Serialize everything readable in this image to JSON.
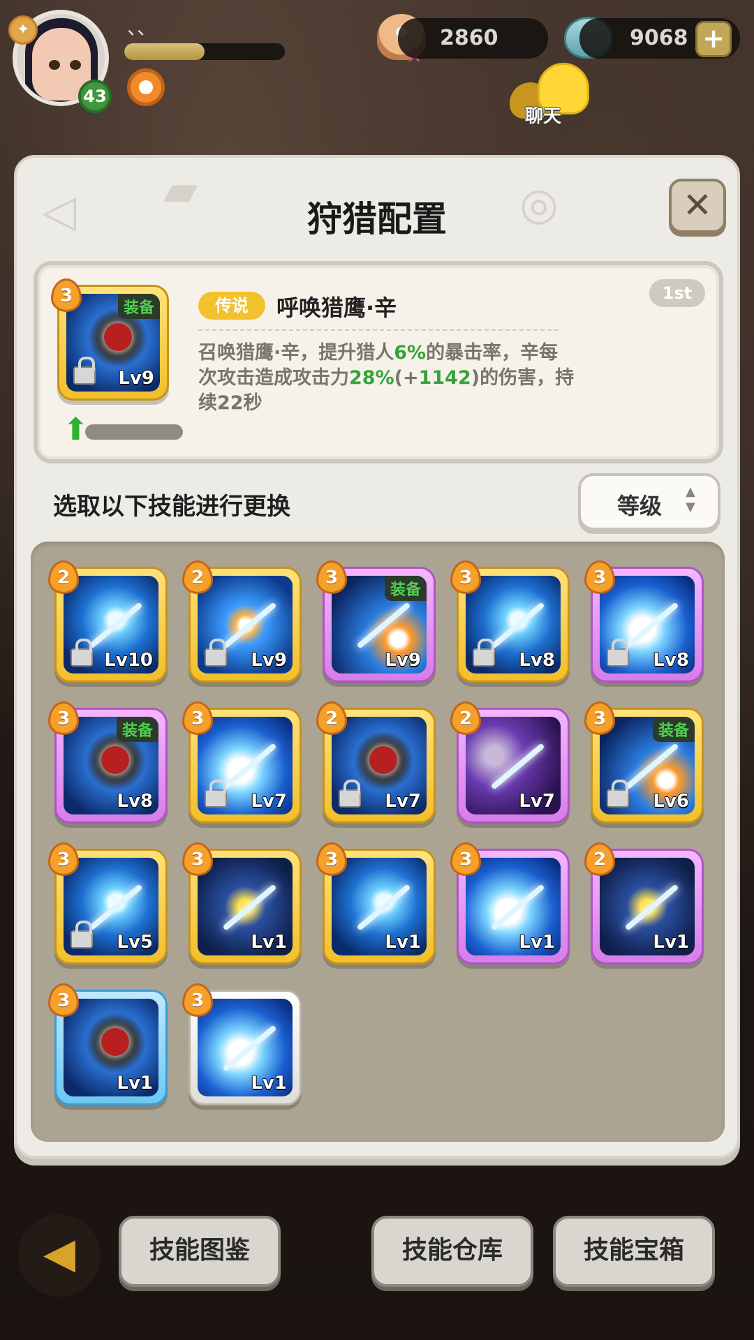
{
  "hud": {
    "player_name": "、、",
    "level": "43",
    "exp_fraction": 0.5,
    "currency_shell": "2860",
    "currency_clam": "9068",
    "chat_label": "聊天"
  },
  "panel": {
    "title": "狩猎配置",
    "detail": {
      "star": "3",
      "equipped_tag": "装备",
      "level": "Lv9",
      "rank": "1st",
      "rarity": "传说",
      "name": "呼唤猎鹰·辛",
      "desc_1": "召唤猎鹰·辛，提升猎人",
      "desc_2": "6%",
      "desc_3": "的暴击率，辛每次攻击造成攻击力",
      "desc_4": "28%",
      "desc_5": "(+",
      "desc_6": "1142",
      "desc_7": ")的伤害，持续22秒"
    },
    "section_label": "选取以下技能进行更换",
    "sort_label": "等级",
    "skills": [
      {
        "star": "2",
        "level": "Lv10",
        "frame": "gold",
        "locked": true,
        "equipped": false,
        "art": "a1"
      },
      {
        "star": "2",
        "level": "Lv9",
        "frame": "gold",
        "locked": true,
        "equipped": false,
        "art": "a2"
      },
      {
        "star": "3",
        "level": "Lv9",
        "frame": "purple",
        "locked": false,
        "equipped": true,
        "art": "a3"
      },
      {
        "star": "3",
        "level": "Lv8",
        "frame": "gold",
        "locked": true,
        "equipped": false,
        "art": "a1"
      },
      {
        "star": "3",
        "level": "Lv8",
        "frame": "purple",
        "locked": true,
        "equipped": false,
        "art": "a6"
      },
      {
        "star": "3",
        "level": "Lv8",
        "frame": "purple",
        "locked": false,
        "equipped": true,
        "art": "bird"
      },
      {
        "star": "3",
        "level": "Lv7",
        "frame": "gold",
        "locked": true,
        "equipped": false,
        "art": "a6"
      },
      {
        "star": "2",
        "level": "Lv7",
        "frame": "gold",
        "locked": true,
        "equipped": false,
        "art": "bird"
      },
      {
        "star": "2",
        "level": "Lv7",
        "frame": "purple",
        "locked": false,
        "equipped": false,
        "art": "a4"
      },
      {
        "star": "3",
        "level": "Lv6",
        "frame": "gold",
        "locked": true,
        "equipped": true,
        "art": "a3"
      },
      {
        "star": "3",
        "level": "Lv5",
        "frame": "gold",
        "locked": true,
        "equipped": false,
        "art": "a1"
      },
      {
        "star": "3",
        "level": "Lv1",
        "frame": "gold",
        "locked": false,
        "equipped": false,
        "art": "a5"
      },
      {
        "star": "3",
        "level": "Lv1",
        "frame": "gold",
        "locked": false,
        "equipped": false,
        "art": "a1"
      },
      {
        "star": "3",
        "level": "Lv1",
        "frame": "purple",
        "locked": false,
        "equipped": false,
        "art": "a6"
      },
      {
        "star": "2",
        "level": "Lv1",
        "frame": "purple",
        "locked": false,
        "equipped": false,
        "art": "a5"
      },
      {
        "star": "3",
        "level": "Lv1",
        "frame": "blue",
        "locked": false,
        "equipped": false,
        "art": "bird"
      },
      {
        "star": "3",
        "level": "Lv1",
        "frame": "white",
        "locked": false,
        "equipped": false,
        "art": "a6"
      }
    ],
    "equip_tag": "装备"
  },
  "nav": {
    "back_icon": "back-arrow-icon",
    "btn_codex": "技能图鉴",
    "btn_storage": "技能仓库",
    "btn_chest": "技能宝箱"
  }
}
